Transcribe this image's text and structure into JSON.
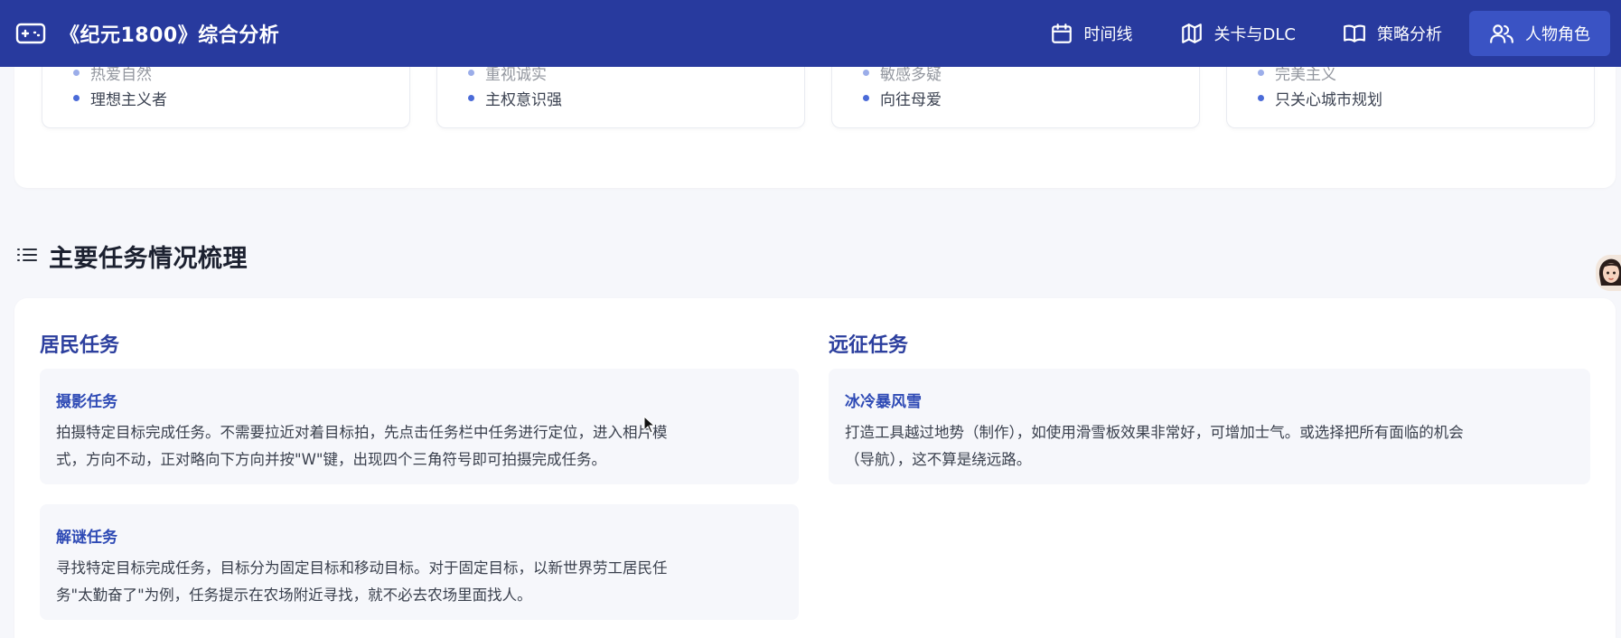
{
  "app": {
    "title": "《纪元1800》综合分析",
    "icon": "gamepad-icon"
  },
  "nav": {
    "items": [
      {
        "label": "时间线",
        "icon": "calendar-icon",
        "active": false
      },
      {
        "label": "关卡与DLC",
        "icon": "map-icon",
        "active": false
      },
      {
        "label": "策略分析",
        "icon": "book-icon",
        "active": false
      },
      {
        "label": "人物角色",
        "icon": "users-icon",
        "active": true
      }
    ]
  },
  "traits": {
    "cards": [
      {
        "partial": "热爱自然",
        "full": "理想主义者"
      },
      {
        "partial": "重视诚实",
        "full": "主权意识强"
      },
      {
        "partial": "敏感多疑",
        "full": "向往母爱"
      },
      {
        "partial": "完美主义",
        "full": "只关心城市规划"
      }
    ]
  },
  "section": {
    "title": "主要任务情况梳理",
    "icon": "list-icon"
  },
  "columns": {
    "resident": {
      "title": "居民任务",
      "tasks": [
        {
          "name": "摄影任务",
          "line1": "拍摄特定目标完成任务。不需要拉近对着目标拍，先点击任务栏中任务进行定位，进入相片模",
          "line2": "式，方向不动，正对略向下方向并按\"W\"键，出现四个三角符号即可拍摄完成任务。"
        },
        {
          "name": "解谜任务",
          "line1": "寻找特定目标完成任务，目标分为固定目标和移动目标。对于固定目标，以新世界劳工居民任",
          "line2": "务\"太勤奋了\"为例，任务提示在农场附近寻找，就不必去农场里面找人。"
        }
      ]
    },
    "expedition": {
      "title": "远征任务",
      "tasks": [
        {
          "name": "冰冷暴风雪",
          "line1": "打造工具越过地势（制作），如使用滑雪板效果非常好，可增加士气。或选择把所有面临的机会",
          "line2": "（导航），这不算是绕远路。"
        }
      ]
    }
  },
  "colors": {
    "topbar": "#283a9e",
    "nav_active": "#3a53c4",
    "accent_title": "#2c3f9e",
    "task_name": "#2e4ab5",
    "bullet": "#4b6bd8"
  }
}
